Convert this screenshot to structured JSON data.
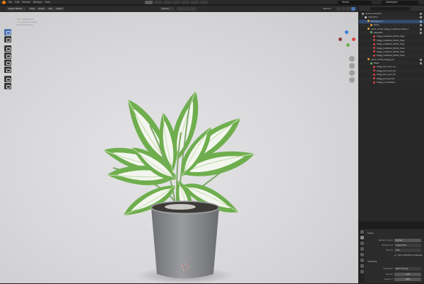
{
  "topbar": {
    "menu": [
      "File",
      "Edit",
      "Render",
      "Window",
      "Help"
    ],
    "scene": "Scene",
    "view_layer": "ViewLayer"
  },
  "viewport_header": {
    "mode": "Object Mode",
    "menus": [
      "View",
      "Select",
      "Add",
      "Object"
    ],
    "transform": "Global",
    "options": "Options"
  },
  "viewport_info": {
    "line1": "User Perspective",
    "line2": "(1) Collection | plant",
    "line3": "Rendering Done"
  },
  "outliner": {
    "title": "Scene Collection",
    "rows": [
      {
        "label": "Scene Collection",
        "indent": 1,
        "color": "#9a9a9a"
      },
      {
        "label": "Collection",
        "indent": 2,
        "color": "#d0d0d0"
      },
      {
        "label": "Background",
        "indent": 3,
        "color": "#e8a33c",
        "selected": true
      },
      {
        "label": "Plane",
        "indent": 4,
        "color": "#e8a33c"
      },
      {
        "label": "plant_13700_Zlagg_Calathea_White_F",
        "indent": 3,
        "color": "#e8a33c"
      },
      {
        "label": "Mesh001",
        "indent": 4,
        "color": "#62b36b"
      },
      {
        "label": "Zlagg_Calathea_White_Tiger",
        "indent": 5,
        "color": "#d8454b"
      },
      {
        "label": "Zlagg_Calathea_White_Tiger",
        "indent": 5,
        "color": "#d8454b"
      },
      {
        "label": "Zlagg_Calathea_White_Tiger",
        "indent": 5,
        "color": "#d8454b"
      },
      {
        "label": "Zlagg_Calathea_White_Tiger",
        "indent": 5,
        "color": "#d8454b"
      },
      {
        "label": "Zlagg_Calathea_White_Tiger",
        "indent": 5,
        "color": "#d8454b"
      },
      {
        "label": "Zlagg_Calathea_White_Tiger",
        "indent": 5,
        "color": "#d8454b"
      },
      {
        "label": "plant_13700_Zlagg_pot",
        "indent": 3,
        "color": "#e8a33c"
      },
      {
        "label": "Mesh",
        "indent": 4,
        "color": "#62b36b"
      },
      {
        "label": "Zlagg_Pot_color_01",
        "indent": 5,
        "color": "#d8454b"
      },
      {
        "label": "Zlagg_Pot_color_02",
        "indent": 5,
        "color": "#d8454b"
      },
      {
        "label": "Zlagg_Pot_color_03",
        "indent": 5,
        "color": "#d8454b"
      },
      {
        "label": "Zlagg_pot_ground",
        "indent": 5,
        "color": "#d8454b"
      },
      {
        "label": "Zlagg_pot_pebbles",
        "indent": 5,
        "color": "#d8454b"
      }
    ]
  },
  "properties": {
    "section": "Scene",
    "render_engine_label": "Render Engine",
    "render_engine": "Cycles",
    "feature_set_label": "Feature Set",
    "feature_set": "Supported",
    "device_label": "Device",
    "device": "CPU",
    "osl_label": "Open Shading Language",
    "sampling": "Sampling",
    "integrator_label": "Integrator",
    "integrator": "Path Tracing",
    "render_label": "Render",
    "render_samples": "128",
    "viewport_label": "Viewport",
    "viewport_samples": "1024"
  },
  "colors": {
    "accent": "#4772b3",
    "leaf_green": "#6fae4e",
    "leaf_white": "#f3f6ee",
    "pot": "#8a8c8f"
  }
}
